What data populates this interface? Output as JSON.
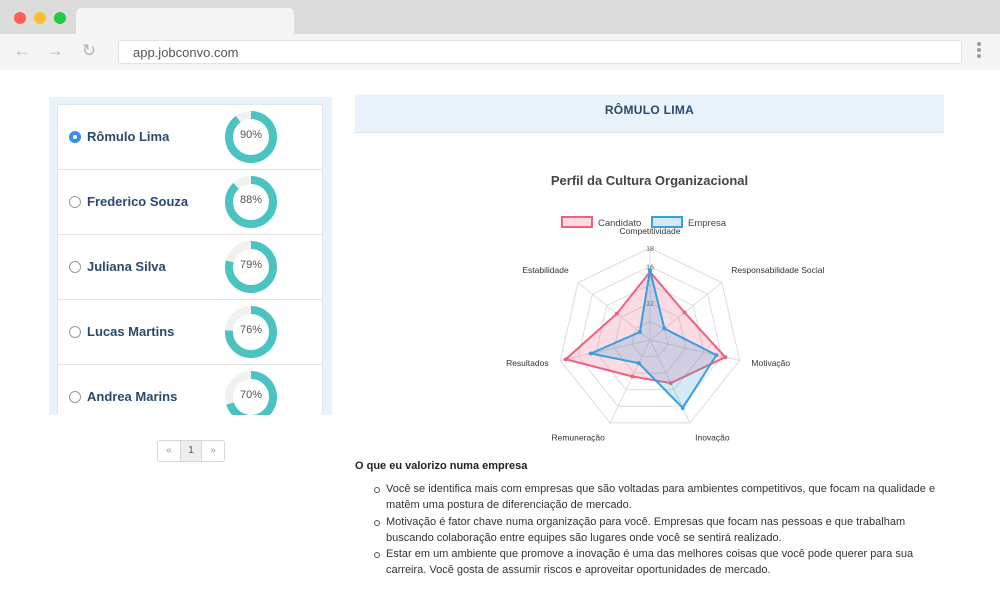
{
  "browser": {
    "url": "app.jobconvo.com"
  },
  "candidates": [
    {
      "name": "Rômulo Lima",
      "score": 90,
      "score_label": "90%",
      "selected": true
    },
    {
      "name": "Frederico Souza",
      "score": 88,
      "score_label": "88%",
      "selected": false
    },
    {
      "name": "Juliana Silva",
      "score": 79,
      "score_label": "79%",
      "selected": false
    },
    {
      "name": "Lucas Martins",
      "score": 76,
      "score_label": "76%",
      "selected": false
    },
    {
      "name": "Andrea Marins",
      "score": 70,
      "score_label": "70%",
      "selected": false
    }
  ],
  "pagination": {
    "prev": "«",
    "current": "1",
    "next": "»"
  },
  "profile": {
    "name": "RÔMULO LIMA"
  },
  "colors": {
    "accent_teal": "#4cc3c3",
    "candidate_series": "#f0607f",
    "empresa_series": "#3a9ee0"
  },
  "chart_data": {
    "type": "radar",
    "title": "Perfil da Cultura Organizacional",
    "axes": [
      "Competitividade",
      "Responsabilidade Social",
      "Motivação",
      "Inovação",
      "Remuneração",
      "Resultados",
      "Estabilidade"
    ],
    "tick_labels": [
      "12",
      "16",
      "18"
    ],
    "range": [
      8,
      18
    ],
    "series": [
      {
        "name": "Candidato",
        "values": [
          15.4,
          12.8,
          16.4,
          13.2,
          12.4,
          17.4,
          12.6
        ]
      },
      {
        "name": "Empresa",
        "values": [
          15.6,
          10.0,
          15.4,
          16.2,
          10.8,
          14.6,
          9.4
        ]
      }
    ],
    "legend_position": "top"
  },
  "values_section": {
    "title": "O que eu valorizo numa empresa",
    "items": [
      "Você se identifica mais com empresas que são voltadas para ambientes competitivos, que focam na qualidade e matêm uma postura de diferenciação de mercado.",
      "Motivação é fator chave numa organização para você. Empresas que focam nas pessoas e que trabalham buscando colaboração entre equipes são lugares onde você se sentirá realizado.",
      "Estar em um ambiente que promove a inovação é uma das melhores coisas que você pode querer para sua carreira. Você gosta de assumir riscos e aproveitar oportunidades de mercado."
    ]
  }
}
